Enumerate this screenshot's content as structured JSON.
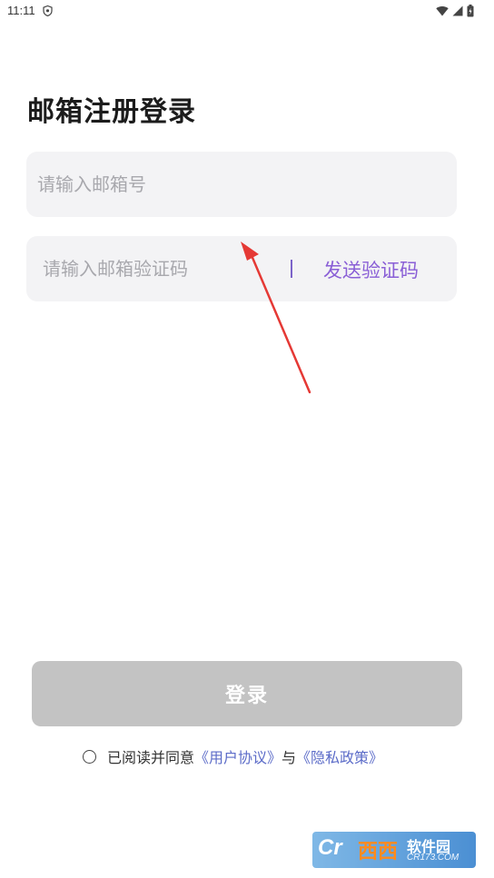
{
  "status_bar": {
    "time": "11:11",
    "icons": [
      "shield-icon",
      "wifi-icon",
      "cell-signal-icon",
      "battery-icon"
    ]
  },
  "page": {
    "title": "邮箱注册登录"
  },
  "form": {
    "email_placeholder": "请输入邮箱号",
    "email_value": "",
    "code_placeholder": "请输入邮箱验证码",
    "code_value": "",
    "send_code_label": "发送验证码"
  },
  "login": {
    "button_label": "登录"
  },
  "agreement": {
    "prefix": "已阅读并同意",
    "user_agreement": "《用户协议》",
    "conjunction": "与",
    "privacy_policy": "《隐私政策》",
    "checked": false
  },
  "watermark": {
    "logo": "Cr",
    "brand": "西西",
    "site": "软件园",
    "url": "CR173.COM"
  },
  "colors": {
    "accent": "#8a5fd6",
    "link": "#5b6bc8",
    "button_disabled": "#c3c3c3",
    "field_bg": "#f3f3f5",
    "annotation_arrow": "#e53935"
  }
}
